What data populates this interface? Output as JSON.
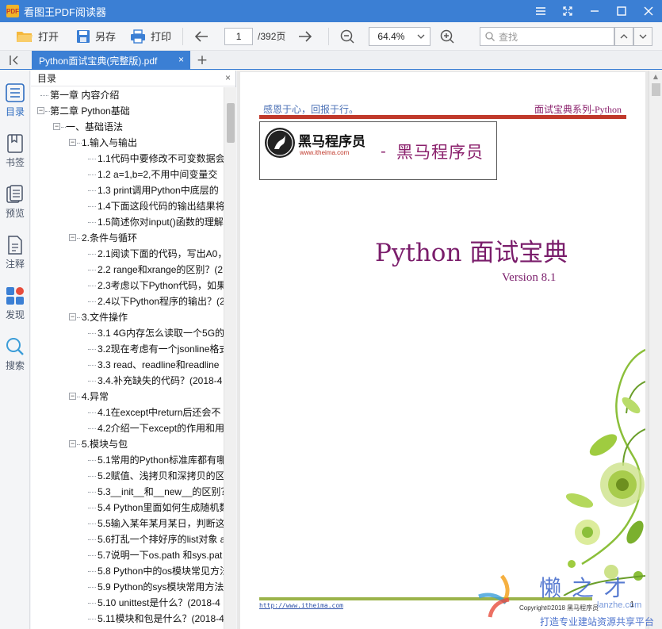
{
  "window": {
    "app_icon_text": "PDF",
    "title": "看图王PDF阅读器",
    "buttons": [
      "menu",
      "fullscreen",
      "minimize",
      "maximize",
      "close"
    ]
  },
  "toolbar": {
    "open_label": "打开",
    "saveas_label": "另存",
    "print_label": "打印",
    "page_current": "1",
    "page_total": "/392页",
    "zoom_value": "64.4%",
    "search_placeholder": "查找"
  },
  "tabbar": {
    "doc_tab_label": "Python面试宝典(完整版).pdf",
    "close_glyph": "×",
    "add_glyph": "+"
  },
  "sidebar": {
    "items": [
      {
        "label": "目录",
        "icon": "list-icon",
        "active": true
      },
      {
        "label": "书签",
        "icon": "bookmark-icon",
        "active": false
      },
      {
        "label": "预览",
        "icon": "preview-icon",
        "active": false
      },
      {
        "label": "注释",
        "icon": "annotation-icon",
        "active": false
      },
      {
        "label": "发现",
        "icon": "discover-icon",
        "active": false
      },
      {
        "label": "搜索",
        "icon": "search-icon",
        "active": false
      }
    ]
  },
  "outline": {
    "header": "目录",
    "close_glyph": "×",
    "items": [
      {
        "label": "第一章 内容介绍",
        "level": 0,
        "toggle": ""
      },
      {
        "label": "第二章 Python基础",
        "level": 0,
        "toggle": "−"
      },
      {
        "label": "一、基础语法",
        "level": 1,
        "toggle": "−"
      },
      {
        "label": "1.输入与输出",
        "level": 2,
        "toggle": "−"
      },
      {
        "label": "1.1代码中要修改不可变数据会",
        "level": 3,
        "toggle": ""
      },
      {
        "label": "1.2 a=1,b=2,不用中间变量交",
        "level": 3,
        "toggle": ""
      },
      {
        "label": "1.3 print调用Python中底层的",
        "level": 3,
        "toggle": ""
      },
      {
        "label": "1.4下面这段代码的输出结果将",
        "level": 3,
        "toggle": ""
      },
      {
        "label": "1.5简述你对input()函数的理解",
        "level": 3,
        "toggle": ""
      },
      {
        "label": "2.条件与循环",
        "level": 2,
        "toggle": "−"
      },
      {
        "label": "2.1阅读下面的代码，写出A0，",
        "level": 3,
        "toggle": ""
      },
      {
        "label": "2.2 range和xrange的区别？(2",
        "level": 3,
        "toggle": ""
      },
      {
        "label": "2.3考虑以下Python代码，如果",
        "level": 3,
        "toggle": ""
      },
      {
        "label": "2.4以下Python程序的输出？(2",
        "level": 3,
        "toggle": ""
      },
      {
        "label": "3.文件操作",
        "level": 2,
        "toggle": "−"
      },
      {
        "label": "3.1 4G内存怎么读取一个5G的",
        "level": 3,
        "toggle": ""
      },
      {
        "label": "3.2现在考虑有一个jsonline格式",
        "level": 3,
        "toggle": ""
      },
      {
        "label": "3.3 read、readline和readline",
        "level": 3,
        "toggle": ""
      },
      {
        "label": "3.4.补充缺失的代码？(2018-4",
        "level": 3,
        "toggle": ""
      },
      {
        "label": "4.异常",
        "level": 2,
        "toggle": "−"
      },
      {
        "label": "4.1在except中return后还会不",
        "level": 3,
        "toggle": ""
      },
      {
        "label": "4.2介绍一下except的作用和用",
        "level": 3,
        "toggle": ""
      },
      {
        "label": "5.模块与包",
        "level": 2,
        "toggle": "−"
      },
      {
        "label": "5.1常用的Python标准库都有哪",
        "level": 3,
        "toggle": ""
      },
      {
        "label": "5.2赋值、浅拷贝和深拷贝的区",
        "level": 3,
        "toggle": ""
      },
      {
        "label": "5.3__init__和__new__的区别？",
        "level": 3,
        "toggle": ""
      },
      {
        "label": "5.4 Python里面如何生成随机数",
        "level": 3,
        "toggle": ""
      },
      {
        "label": "5.5输入某年某月某日，判断这",
        "level": 3,
        "toggle": ""
      },
      {
        "label": "5.6打乱一个排好序的list对象 a",
        "level": 3,
        "toggle": ""
      },
      {
        "label": "5.7说明一下os.path 和sys.pat",
        "level": 3,
        "toggle": ""
      },
      {
        "label": "5.8 Python中的os模块常见方法",
        "level": 3,
        "toggle": ""
      },
      {
        "label": "5.9 Python的sys模块常用方法",
        "level": 3,
        "toggle": ""
      },
      {
        "label": "5.10 unittest是什么？(2018-4",
        "level": 3,
        "toggle": ""
      },
      {
        "label": "5.11模块和包是什么？(2018-4",
        "level": 3,
        "toggle": ""
      }
    ]
  },
  "document": {
    "header_left": "感恩于心，回报于行。",
    "header_right": "面试宝典系列-Python",
    "logo_name": "黑马程序员",
    "logo_url": "www.itheima.com",
    "logo_dash": "-",
    "logo_slogan": "黑马程序员",
    "title": "Python 面试宝典",
    "version": "Version  8.1",
    "footer_url": "http://www.itheima.com",
    "footer_copy": "Copyright©2018 黑马程序员",
    "footer_page": "1"
  },
  "watermark": {
    "text": "懒 之 才",
    "sub": "打造专业建站资源共享平台",
    "url": "lanzhe.com"
  },
  "colors": {
    "accent": "#3b7fd4",
    "title_purple": "#7a1d6b",
    "header_red": "#c0392b",
    "footer_green": "#9bb34a"
  }
}
